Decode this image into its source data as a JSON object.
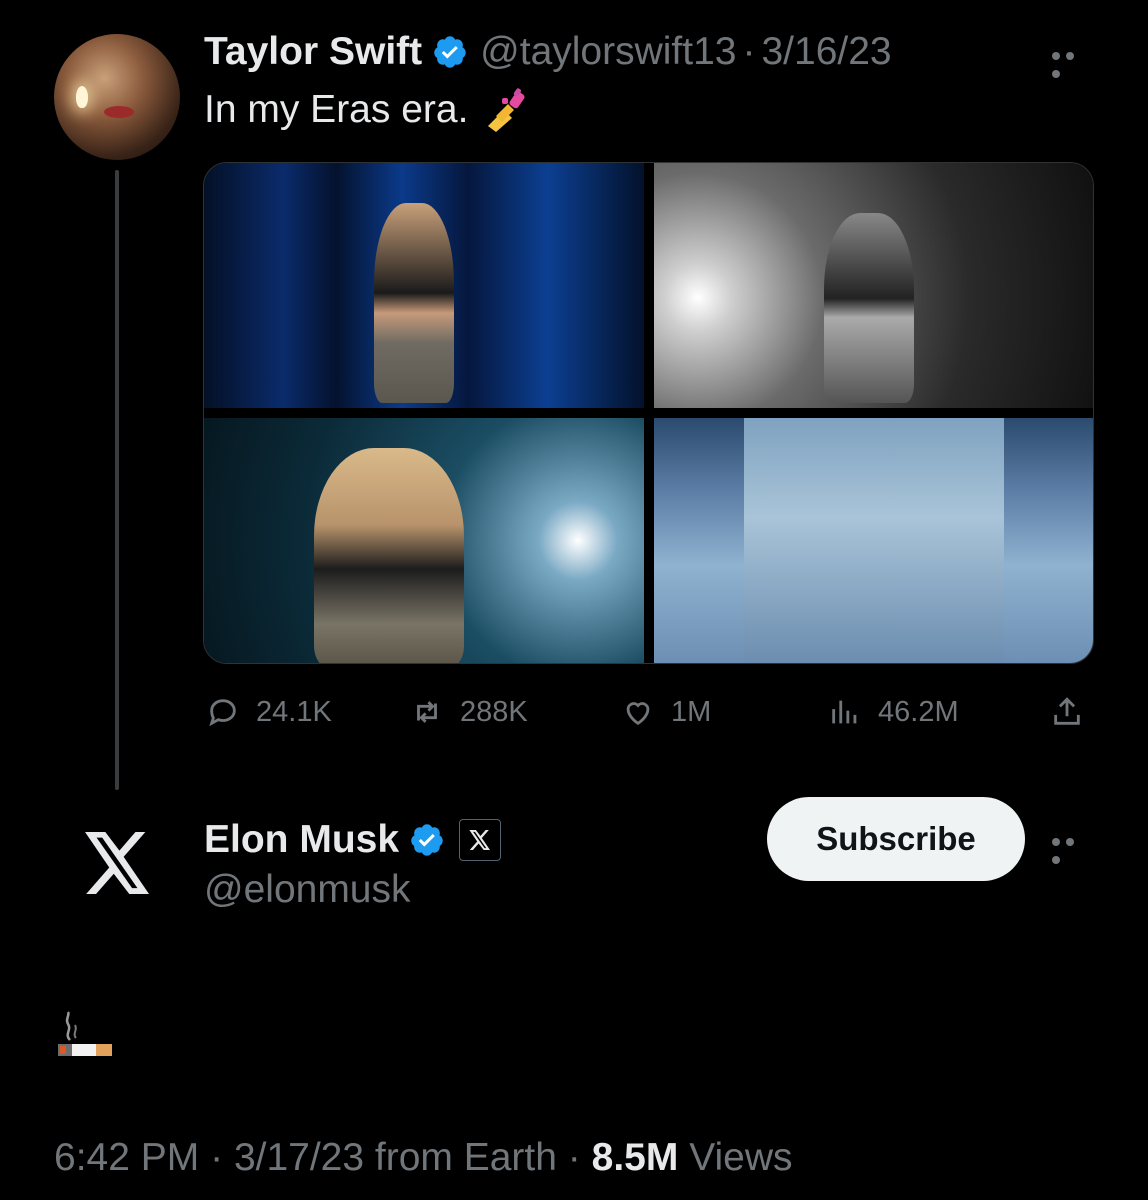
{
  "quoted_tweet": {
    "author_name": "Taylor Swift",
    "handle": "@taylorswift13",
    "separator": "·",
    "date": "3/16/23",
    "text": "In my Eras era.",
    "emoji": "nail-polish",
    "photos": [
      "concert-photo-1",
      "concert-photo-2",
      "concert-photo-3",
      "concert-photo-4"
    ],
    "stats": {
      "replies": "24.1K",
      "retweets": "288K",
      "likes": "1M",
      "views": "46.2M"
    }
  },
  "tweet": {
    "author_name": "Elon Musk",
    "handle": "@elonmusk",
    "subscribe_label": "Subscribe",
    "emoji": "cigarette",
    "time": "6:42 PM",
    "separator": "·",
    "date_source": "3/17/23 from Earth",
    "view_count": "8.5M",
    "views_label": "Views"
  },
  "colors": {
    "background": "#000000",
    "text": "#e7e9ea",
    "muted": "#71767b",
    "verified": "#1d9bf0",
    "button": "#eff3f4"
  }
}
